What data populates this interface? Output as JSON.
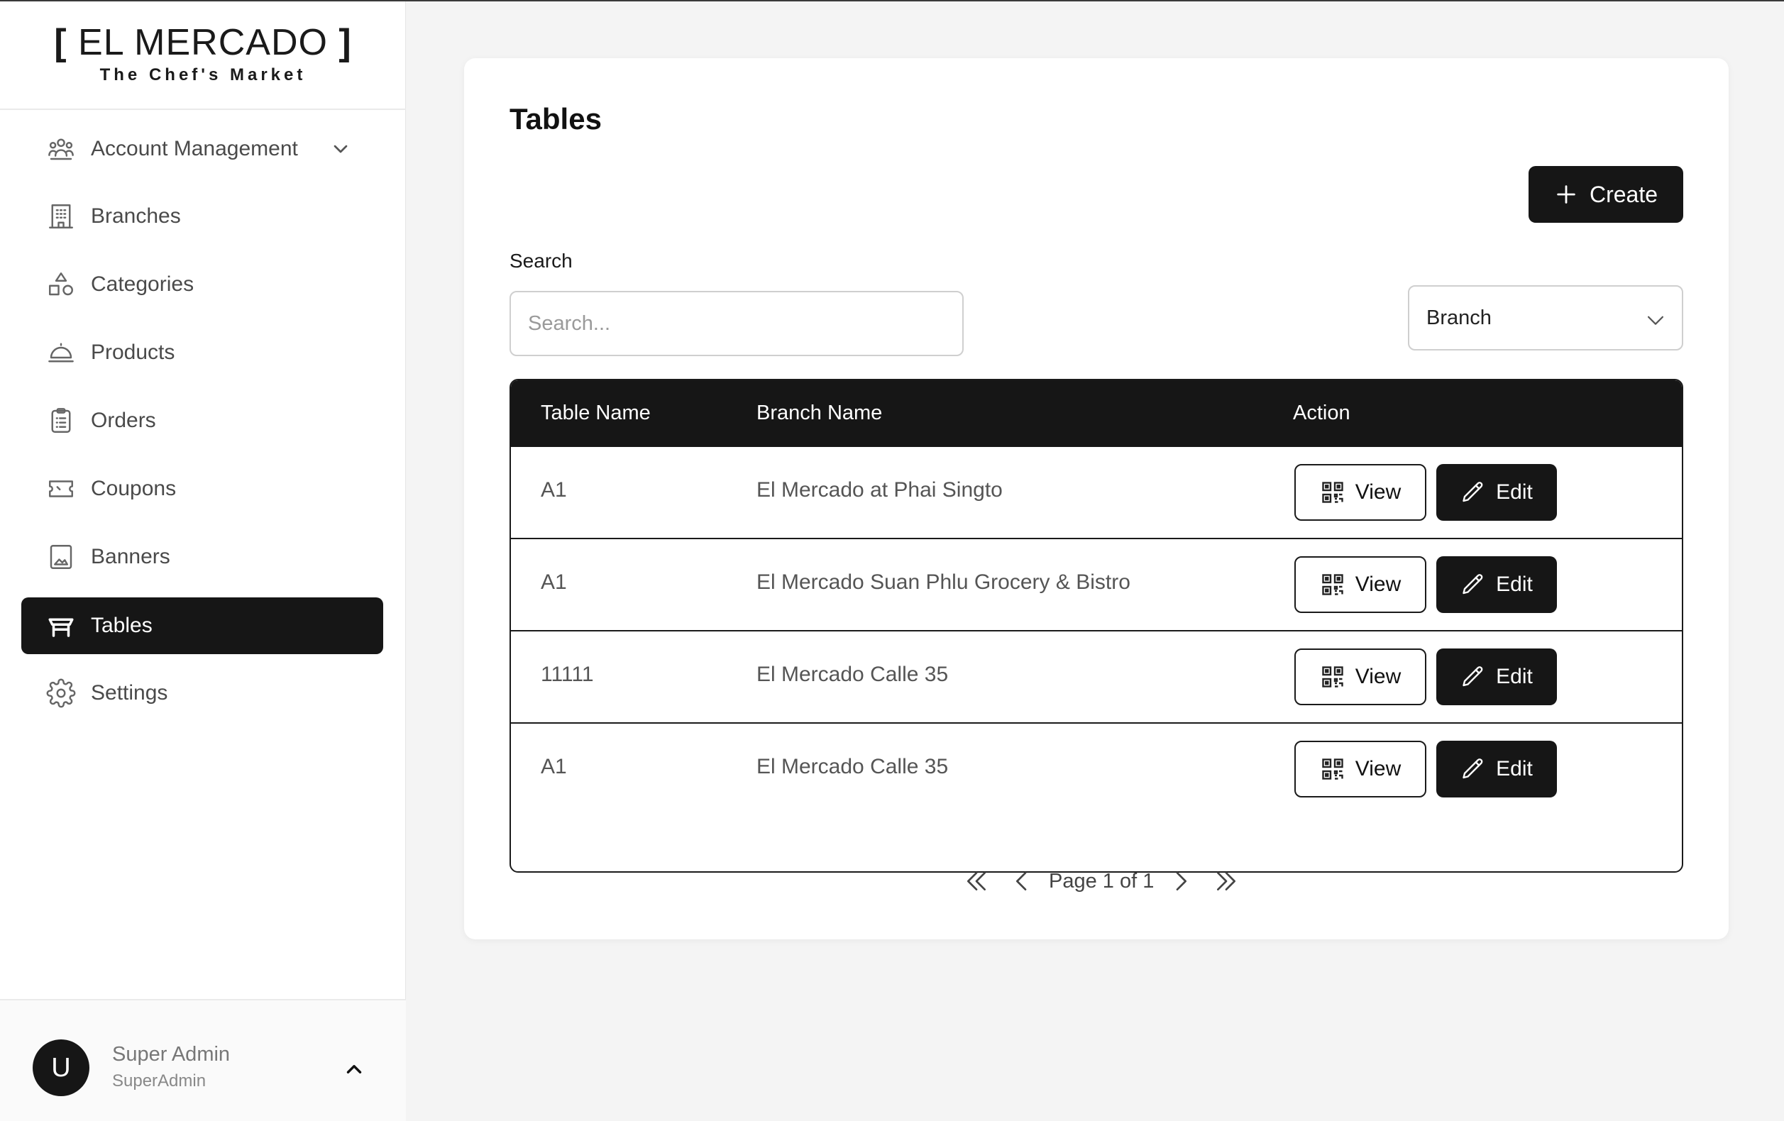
{
  "brand": {
    "title": "EL MERCADO",
    "left_bracket": "[",
    "right_bracket": "]",
    "subtitle": "The Chef's Market"
  },
  "sidebar": {
    "items": [
      {
        "label": "Account Management",
        "icon": "users-icon",
        "expandable": true
      },
      {
        "label": "Branches",
        "icon": "building-icon"
      },
      {
        "label": "Categories",
        "icon": "shapes-icon"
      },
      {
        "label": "Products",
        "icon": "cloche-icon"
      },
      {
        "label": "Orders",
        "icon": "clipboard-icon"
      },
      {
        "label": "Coupons",
        "icon": "ticket-icon"
      },
      {
        "label": "Banners",
        "icon": "image-icon"
      },
      {
        "label": "Tables",
        "icon": "table-icon",
        "active": true
      },
      {
        "label": "Settings",
        "icon": "gear-icon"
      }
    ]
  },
  "user": {
    "avatar_letter": "U",
    "name": "Super Admin",
    "role": "SuperAdmin"
  },
  "main": {
    "title": "Tables",
    "create_label": "Create",
    "search_label": "Search",
    "search_placeholder": "Search...",
    "search_value": "",
    "branch_select_value": "Branch",
    "columns": [
      "Table Name",
      "Branch Name",
      "Action"
    ],
    "rows": [
      {
        "table_name": "A1",
        "branch_name": "El Mercado at Phai Singto"
      },
      {
        "table_name": "A1",
        "branch_name": "El Mercado Suan Phlu Grocery & Bistro"
      },
      {
        "table_name": "11111",
        "branch_name": "El Mercado Calle 35"
      },
      {
        "table_name": "A1",
        "branch_name": "El Mercado Calle 35"
      }
    ],
    "view_label": "View",
    "edit_label": "Edit",
    "pagination_text": "Page 1 of 1"
  },
  "colors": {
    "accent_dark": "#161616",
    "background": "#f4f4f4",
    "card": "#ffffff",
    "muted_text": "#555555"
  }
}
